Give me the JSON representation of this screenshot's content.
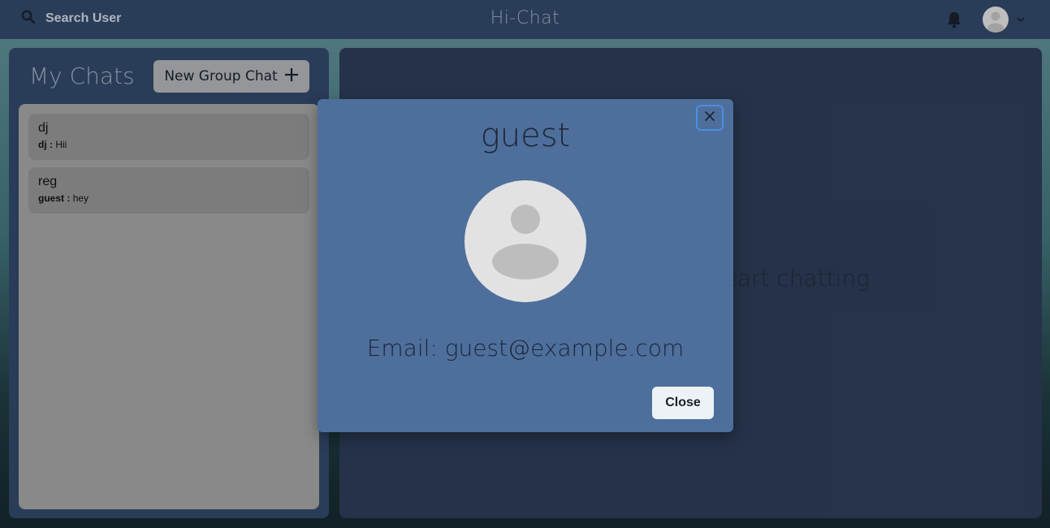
{
  "header": {
    "search_label": "Search User",
    "app_title": "Hi-Chat",
    "icons": {
      "search": "search-icon",
      "notifications": "bell-icon",
      "avatar": "avatar",
      "menu": "chevron-down-icon"
    }
  },
  "sidebar": {
    "title": "My Chats",
    "new_group_label": "New Group Chat",
    "chats": [
      {
        "name": "dj",
        "sender": "dj :",
        "message": "Hii"
      },
      {
        "name": "reg",
        "sender": "guest :",
        "message": "hey"
      }
    ]
  },
  "main": {
    "empty_prompt": "Click on a user to start chatting"
  },
  "modal": {
    "title": "guest",
    "email_label": "Email:",
    "email": "guest@example.com",
    "close_label": "Close"
  },
  "colors": {
    "topbar": "#2f4565",
    "panel": "#2f4565",
    "chat_area": "#2b3a54",
    "modal": "#4e6f9c",
    "focus_ring": "#4b8fe0"
  }
}
